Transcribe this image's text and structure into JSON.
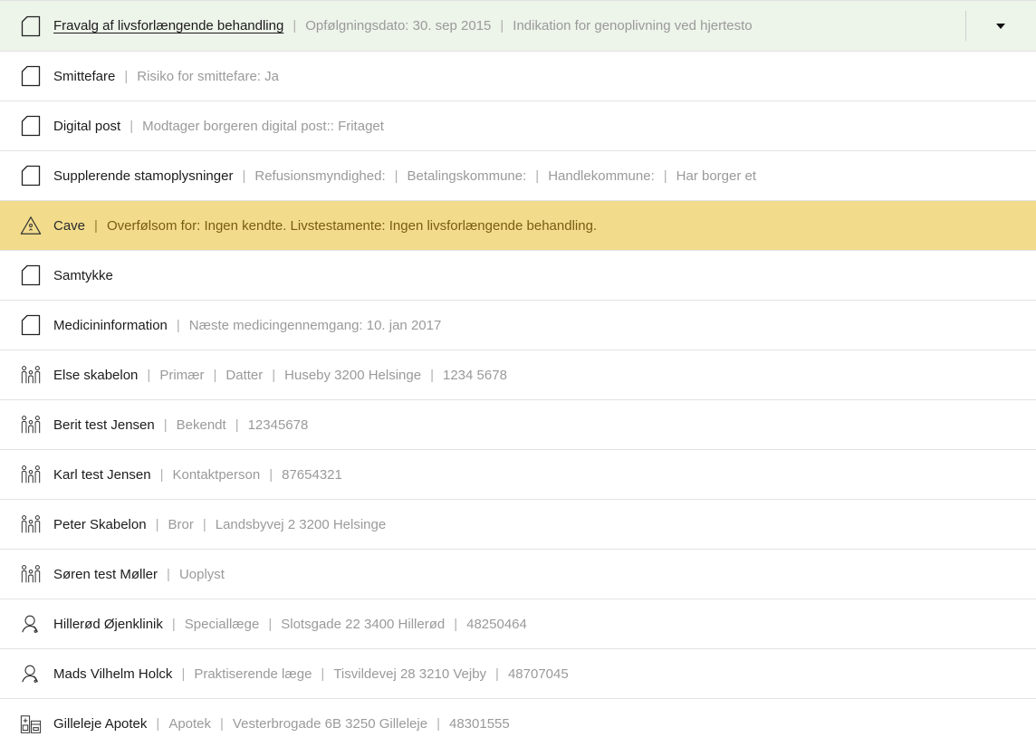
{
  "rows": [
    {
      "type": "doc",
      "title": "Fravalg af livsforlængende behandling",
      "meta": [
        "Opfølgningsdato: 30. sep 2015",
        "Indikation for genoplivning ved hjertesto"
      ]
    },
    {
      "type": "doc",
      "title": "Smittefare",
      "meta": [
        "Risiko for smittefare: Ja"
      ]
    },
    {
      "type": "doc",
      "title": "Digital post",
      "meta": [
        "Modtager borgeren digital post:: Fritaget"
      ]
    },
    {
      "type": "doc",
      "title": "Supplerende stamoplysninger",
      "meta": [
        "Refusionsmyndighed:",
        "Betalingskommune:",
        "Handlekommune:",
        "Har borger et"
      ]
    },
    {
      "type": "warning",
      "title": "Cave",
      "meta": [
        "Overfølsom for: Ingen kendte. Livstestamente: Ingen livsforlængende behandling."
      ]
    },
    {
      "type": "doc",
      "title": "Samtykke",
      "meta": []
    },
    {
      "type": "doc",
      "title": "Medicininformation",
      "meta": [
        "Næste medicingennemgang: 10. jan 2017"
      ]
    },
    {
      "type": "people",
      "title": "Else skabelon",
      "meta": [
        "Primær",
        "Datter",
        "Huseby 3200 Helsinge",
        "1234 5678"
      ]
    },
    {
      "type": "people",
      "title": "Berit test Jensen",
      "meta": [
        "Bekendt",
        "12345678"
      ]
    },
    {
      "type": "people",
      "title": "Karl test Jensen",
      "meta": [
        "Kontaktperson",
        "87654321"
      ]
    },
    {
      "type": "people",
      "title": "Peter Skabelon",
      "meta": [
        "Bror",
        "Landsbyvej 2 3200 Helsinge"
      ]
    },
    {
      "type": "people",
      "title": "Søren test Møller",
      "meta": [
        "Uoplyst"
      ]
    },
    {
      "type": "doctor",
      "title": "Hillerød Øjenklinik",
      "meta": [
        "Speciallæge",
        "Slotsgade 22 3400 Hillerød",
        "48250464"
      ]
    },
    {
      "type": "doctor",
      "title": "Mads Vilhelm Holck",
      "meta": [
        "Praktiserende læge",
        "Tisvildevej 28 3210 Vejby",
        "48707045"
      ]
    },
    {
      "type": "pharmacy",
      "title": "Gilleleje Apotek",
      "meta": [
        "Apotek",
        "Vesterbrogade 6B 3250 Gilleleje",
        "48301555"
      ]
    }
  ],
  "separator": "|",
  "colors": {
    "first_row_bg": "#edf4ea",
    "warning_bg": "#f2dc8c",
    "meta_text": "#9a9a9a",
    "divider": "#e2e2e2"
  },
  "icons": {
    "doc": "document-icon",
    "warning": "warning-triangle-icon",
    "people": "people-icon",
    "doctor": "doctor-icon",
    "pharmacy": "pharmacy-icon"
  }
}
